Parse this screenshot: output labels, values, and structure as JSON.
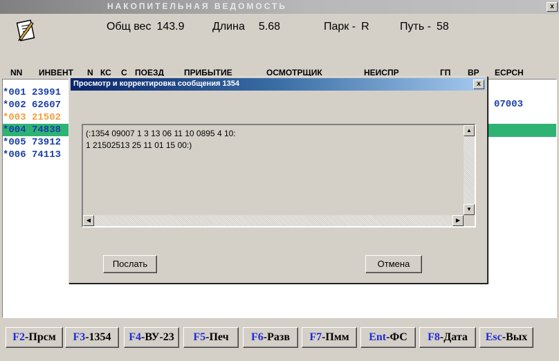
{
  "window": {
    "title": "НАКОПИТЕЛЬНАЯ ВЕДОМОСТЬ",
    "close_label": "x"
  },
  "icons": {
    "document": "document-edit-icon"
  },
  "info": {
    "weight_label": "Общ вес",
    "weight_value": "143.9",
    "length_label": "Длина",
    "length_value": "5.68",
    "park_label": "Парк -",
    "park_value": "R",
    "track_label": "Путь -",
    "track_value": "58"
  },
  "columns": [
    "NN",
    "ИНВЕНТ",
    "N",
    "КС",
    "С",
    "ПОЕЗД",
    "ПРИБЫТИЕ",
    "ОСМОТРЩИК",
    "НЕИСПР",
    "ГП",
    "ВР",
    "ЕСРСН"
  ],
  "rows": [
    {
      "text": "*001 23991",
      "color": "#1b3fa6"
    },
    {
      "text": "*002 62607",
      "color": "#1b3fa6"
    },
    {
      "text": "*003 21502",
      "color": "#f0a040"
    },
    {
      "text": "*004 74838",
      "color": "#1b3fa6",
      "selected": true
    },
    {
      "text": "*005 73912",
      "color": "#1b3fa6"
    },
    {
      "text": "*006 74113",
      "color": "#1b3fa6"
    }
  ],
  "right_value": "07003",
  "dialog": {
    "title": "Просмотр и корректировка сообщения 1354",
    "close_label": "x",
    "message": "(:1354 09007 1 3 13 06 11 10 0895 4 10:\n1 21502513 25 11 01 15 00:)",
    "send_label": "Послать",
    "cancel_label": "Отмена"
  },
  "fkeys": [
    {
      "key": "F2",
      "text": "-Прсм"
    },
    {
      "key": "F3",
      "text": "-1354"
    },
    {
      "key": "F4",
      "text": "-ВУ-23"
    },
    {
      "key": "F5",
      "text": "-Печ"
    },
    {
      "key": "F6",
      "text": "-Разв"
    },
    {
      "key": "F7",
      "text": "-Пмм"
    },
    {
      "key": "Ent",
      "text": "-ФС"
    },
    {
      "key": "F8",
      "text": "-Дата"
    },
    {
      "key": "Esc",
      "text": "-Вых"
    }
  ]
}
